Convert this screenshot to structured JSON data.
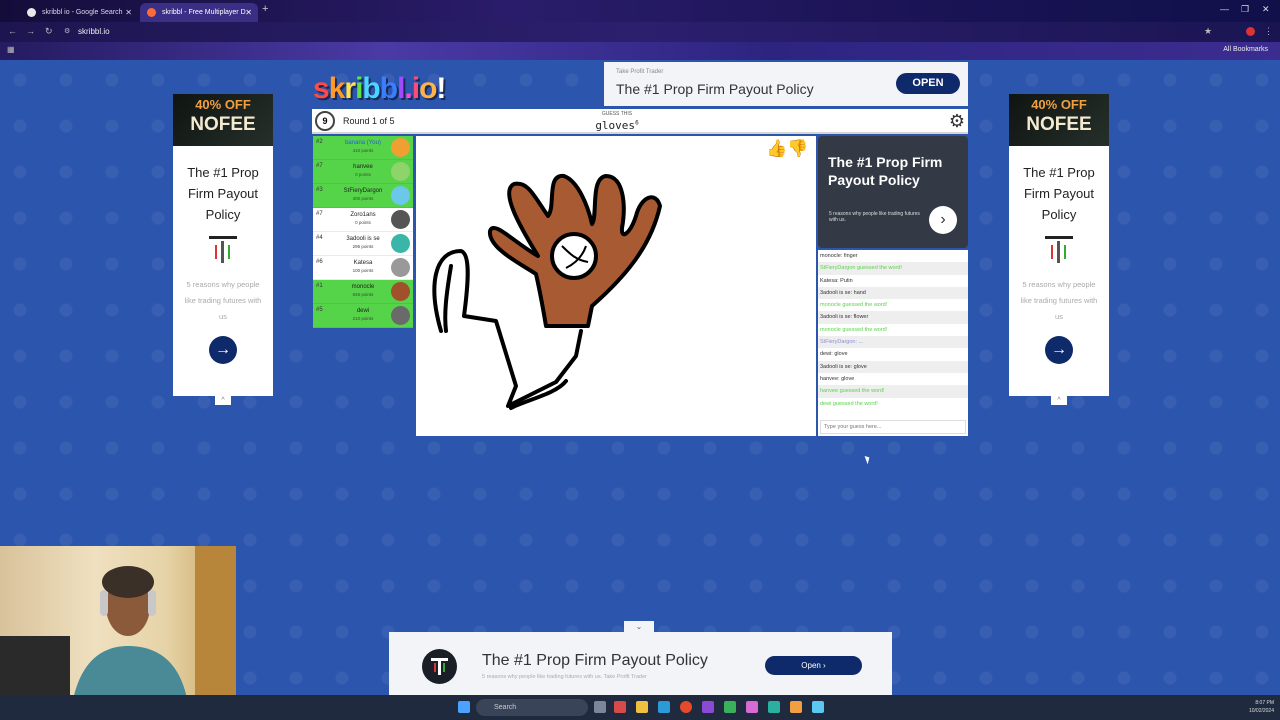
{
  "browser": {
    "tabs": [
      {
        "title": "skribbl io - Google Search"
      },
      {
        "title": "skribbl - Free Multiplayer D"
      }
    ],
    "url": "skribbl.io",
    "bookmarks_label": "All Bookmarks"
  },
  "game": {
    "logo": "skribbl.io!",
    "timer": "9",
    "round": "Round 1 of 5",
    "guess_label": "GUESS THIS",
    "word": "gloves",
    "word_length": "6"
  },
  "players": [
    {
      "rank": "#2",
      "name": "banana (You)",
      "points": "410 points",
      "row": "green",
      "avatar": "#f0a030"
    },
    {
      "rank": "#7",
      "name": "hanvee",
      "points": "0 points",
      "row": "green",
      "avatar": "#8fd46a"
    },
    {
      "rank": "#3",
      "name": "StFieryDargon",
      "points": "300 points",
      "row": "green",
      "avatar": "#6cc8e8"
    },
    {
      "rank": "#7",
      "name": "Zoro1ans",
      "points": "0 points",
      "row": "white",
      "avatar": "#555555"
    },
    {
      "rank": "#4",
      "name": "3adooli is se",
      "points": "295 points",
      "row": "white",
      "avatar": "#3ab6a8"
    },
    {
      "rank": "#6",
      "name": "Katesa",
      "points": "100 points",
      "row": "white",
      "avatar": "#999999"
    },
    {
      "rank": "#1",
      "name": "monocle",
      "points": "646 points",
      "row": "green",
      "avatar": "#a0502a"
    },
    {
      "rank": "#5",
      "name": "dewi",
      "points": "210 points",
      "row": "green",
      "avatar": "#6a6a6a"
    }
  ],
  "chat": {
    "messages": [
      {
        "text": "monocle: finger",
        "style": "normal"
      },
      {
        "text": "StFieryDargon guessed the word!",
        "style": "guess"
      },
      {
        "text": "Katesa: Putin",
        "style": "normal"
      },
      {
        "text": "3adooli is se: hand",
        "style": "normal"
      },
      {
        "text": "monocle guessed the word!",
        "style": "guess"
      },
      {
        "text": "3adooli is se: flower",
        "style": "normal"
      },
      {
        "text": "monocle guessed the word!",
        "style": "guess"
      },
      {
        "text": "StFieryDargon: ...",
        "style": "hint"
      },
      {
        "text": "dewi: glove",
        "style": "normal"
      },
      {
        "text": "3adooli is se: glove",
        "style": "normal"
      },
      {
        "text": "hanvee: glove",
        "style": "normal"
      },
      {
        "text": "hanvee guessed the word!",
        "style": "guess"
      },
      {
        "text": "dewi guessed the word!",
        "style": "guess"
      }
    ],
    "input_placeholder": "Type your guess here..."
  },
  "ads": {
    "top": {
      "small": "Take Profit Trader",
      "headline": "The #1 Prop Firm Payout Policy",
      "button": "OPEN"
    },
    "side": {
      "banner_top": "40% OFF",
      "banner_bottom": "NOFEE",
      "title": "The #1 Prop Firm Payout Policy",
      "desc": "5 reasons why people like trading futures with us"
    },
    "chat": {
      "title": "The #1 Prop Firm Payout Policy",
      "desc": "5 reasons why people like trading futures with us."
    },
    "bottom": {
      "headline": "The #1 Prop Firm Payout Policy",
      "sub": "5 reasons why people like trading futures with us. Take Profit Trader",
      "button": "Open ›"
    }
  },
  "taskbar": {
    "search": "Search",
    "time": "8:07 PM",
    "date": "10/02/2024"
  }
}
